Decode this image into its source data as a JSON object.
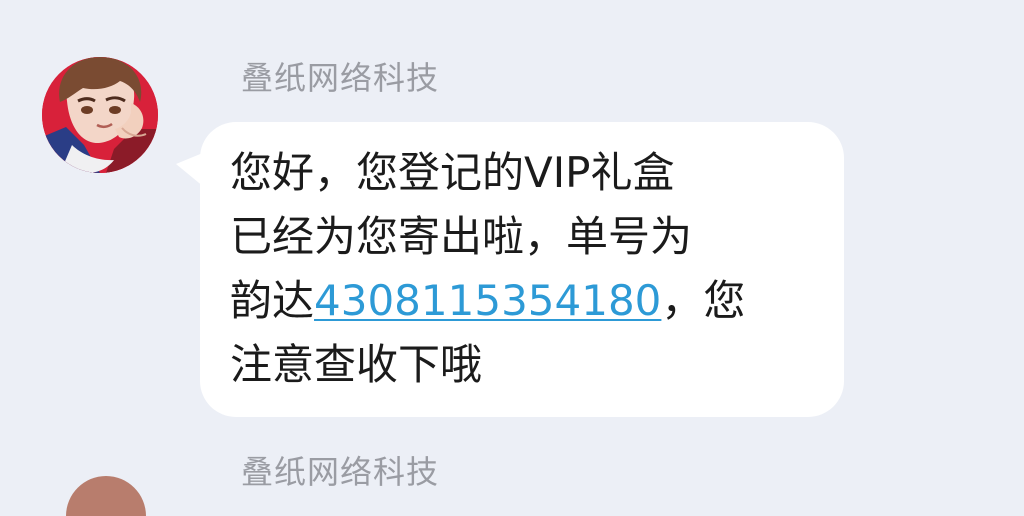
{
  "message": {
    "sender": "叠纸网络科技",
    "avatar": "anime-character-avatar",
    "body": {
      "line1": "您好，您登记的VIP礼盒",
      "line2": "已经为您寄出啦，单号为",
      "line3_prefix": "韵达",
      "tracking_number": "4308115354180",
      "line3_suffix": "，您",
      "line4": "注意查收下哦"
    }
  },
  "next_message": {
    "sender": "叠纸网络科技"
  },
  "colors": {
    "background": "#eceff6",
    "bubble": "#ffffff",
    "link": "#2d9ad6",
    "sender_text": "#9a9ca3"
  }
}
